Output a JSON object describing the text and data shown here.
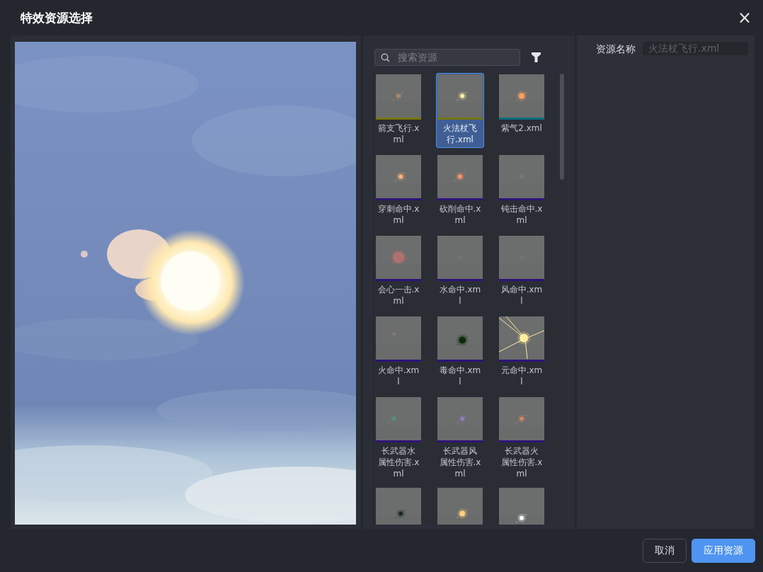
{
  "dialog": {
    "title": "特效资源选择",
    "close": "×"
  },
  "search": {
    "placeholder": "搜索资源"
  },
  "resources": [
    {
      "label": "箭支飞行.xml",
      "selected": false,
      "color": "#76780e"
    },
    {
      "label": "火法杖飞行.xml",
      "selected": true,
      "color": "#76780e"
    },
    {
      "label": "紫气2.xml",
      "selected": false,
      "color": "#0c6f80"
    },
    {
      "label": "穿刺命中.xml",
      "selected": false,
      "color": "#2e1478"
    },
    {
      "label": "砍削命中.xml",
      "selected": false,
      "color": "#2e1478"
    },
    {
      "label": "钝击命中.xml",
      "selected": false,
      "color": "#2e1478"
    },
    {
      "label": "会心一击.xml",
      "selected": false,
      "color": "#2e1478"
    },
    {
      "label": "水命中.xml",
      "selected": false,
      "color": "#2e1478"
    },
    {
      "label": "风命中.xml",
      "selected": false,
      "color": "#2e1478"
    },
    {
      "label": "火命中.xml",
      "selected": false,
      "color": "#2e1478"
    },
    {
      "label": "毒命中.xml",
      "selected": false,
      "color": "#2e1478"
    },
    {
      "label": "元命中.xml",
      "selected": false,
      "color": "#2e1478"
    },
    {
      "label": "长武器水属性伤害.xml",
      "selected": false,
      "color": "#2e1478"
    },
    {
      "label": "长武器风属性伤害.xml",
      "selected": false,
      "color": "#2e1478"
    },
    {
      "label": "长武器火属性伤害.xml",
      "selected": false,
      "color": "#2e1478"
    },
    {
      "selected": false
    },
    {
      "selected": false
    },
    {
      "selected": false
    }
  ],
  "properties": {
    "label": "资源名称",
    "value": "火法杖飞行.xml",
    "disabled": true
  },
  "buttons": [
    {
      "label": "取消",
      "kind": "secondary"
    },
    {
      "label": "应用资源",
      "kind": "primary"
    }
  ]
}
